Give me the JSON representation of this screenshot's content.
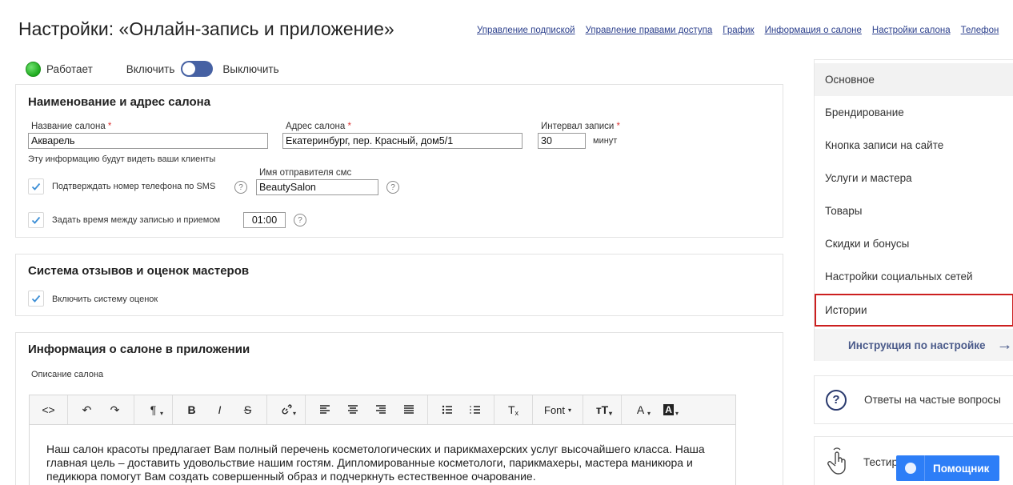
{
  "page": {
    "title": "Настройки: «Онлайн-запись и приложение»"
  },
  "top_links": [
    "Управление подпиской",
    "Управление правами доступа",
    "График",
    "Информация о салоне",
    "Настройки салона",
    "Телефон"
  ],
  "status": {
    "label": "Работает",
    "enable_label": "Включить",
    "disable_label": "Выключить",
    "color": "#22aa22"
  },
  "salon_section": {
    "title": "Наименование и адрес салона",
    "name_label": "Название салона",
    "name_value": "Акварель",
    "address_label": "Адрес салона",
    "address_value": "Екатеринбург, пер. Красный, дом5/1",
    "interval_label": "Интервал записи",
    "interval_value": "30",
    "interval_unit": "минут",
    "required_mark": "*",
    "clients_note": "Эту информацию будут видеть ваши клиенты",
    "sms_confirm_label": "Подтверждать номер телефона по SMS",
    "sms_confirm_checked": true,
    "sender_label": "Имя отправителя смс",
    "sender_value": "BeautySalon",
    "time_between_label": "Задать время между записью и приемом",
    "time_between_checked": true,
    "time_between_value": "01:00",
    "help_glyph": "?"
  },
  "reviews_section": {
    "title": "Система отзывов и оценок мастеров",
    "enable_label": "Включить систему оценок",
    "enable_checked": true
  },
  "app_info_section": {
    "title": "Информация о салоне в приложении",
    "description_label": "Описание салона",
    "toolbar": {
      "font_label": "Font",
      "icons": [
        "code-view-icon",
        "undo-icon",
        "redo-icon",
        "paragraph-icon",
        "bold-icon",
        "italic-icon",
        "strikethrough-icon",
        "link-icon",
        "align-left-icon",
        "align-center-icon",
        "align-right-icon",
        "align-justify-icon",
        "bullet-list-icon",
        "numbered-list-icon",
        "clear-format-icon",
        "font-icon",
        "font-size-icon",
        "text-color-icon",
        "background-color-icon"
      ]
    },
    "description_text": "Наш салон красоты предлагает Вам полный перечень косметологических и парикмахерских услуг высочайшего класса. Наша главная цель – доставить удовольствие нашим гостям. Дипломированные косметологи, парикмахеры, мастера маникюра и педикюра помогут Вам создать совершенный образ и подчеркнуть естественное очарование."
  },
  "sidebar": {
    "items": [
      {
        "label": "Основное",
        "active": true
      },
      {
        "label": "Брендирование"
      },
      {
        "label": "Кнопка записи на сайте"
      },
      {
        "label": "Услуги и мастера"
      },
      {
        "label": "Товары"
      },
      {
        "label": "Скидки и бонусы"
      },
      {
        "label": "Настройки социальных сетей"
      },
      {
        "label": "Истории",
        "highlighted": true
      }
    ],
    "instruction_label": "Инструкция по настройке",
    "instruction_arrow": "→",
    "highlight_color": "#cc1f1f"
  },
  "faq": {
    "icon_glyph": "?",
    "label": "Ответы на частые вопросы"
  },
  "test_box": {
    "label": "Тестир"
  },
  "helper_button": {
    "label": "Помощник",
    "color": "#2d7ef7"
  }
}
